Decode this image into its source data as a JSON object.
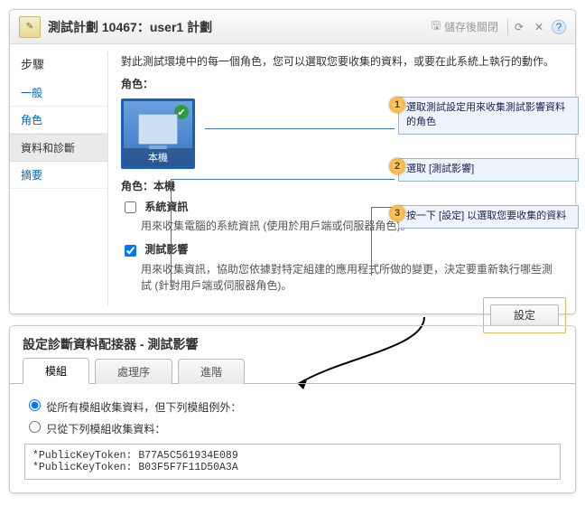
{
  "header": {
    "title": "測試計劃 10467：user1 計劃",
    "save_close": "儲存後關閉"
  },
  "sidebar": {
    "title": "步驟",
    "items": [
      "一般",
      "角色",
      "資料和診斷",
      "摘要"
    ]
  },
  "main": {
    "intro": "對此測試環境中的每一個角色，您可以選取您要收集的資料，或要在此系統上執行的動作。",
    "role_label": "角色：",
    "role_tile": "本機",
    "role_section": "角色：本機",
    "sysinfo": {
      "title": "系統資訊",
      "desc": "用來收集電腦的系統資訊 (使用於用戶端或伺服器角色)。"
    },
    "impact": {
      "title": "測試影響",
      "desc": "用來收集資訊，協助您依據對特定組建的應用程式所做的變更，決定要重新執行哪些測試 (針對用戶端或伺服器角色)。"
    },
    "settings_btn": "設定"
  },
  "callouts": {
    "c1": "選取測試設定用來收集測試影響資料的角色",
    "c2": "選取 [測試影響]",
    "c3": "按一下 [設定] 以選取您要收集的資料"
  },
  "dialog": {
    "title": "設定診斷資料配接器 - 測試影響",
    "tabs": [
      "模組",
      "處理序",
      "進階"
    ],
    "opt1": "從所有模組收集資料，但下列模組例外：",
    "opt2": "只從下列模組收集資料：",
    "keys": "*PublicKeyToken: B77A5C561934E089\n*PublicKeyToken: B03F5F7F11D50A3A"
  }
}
